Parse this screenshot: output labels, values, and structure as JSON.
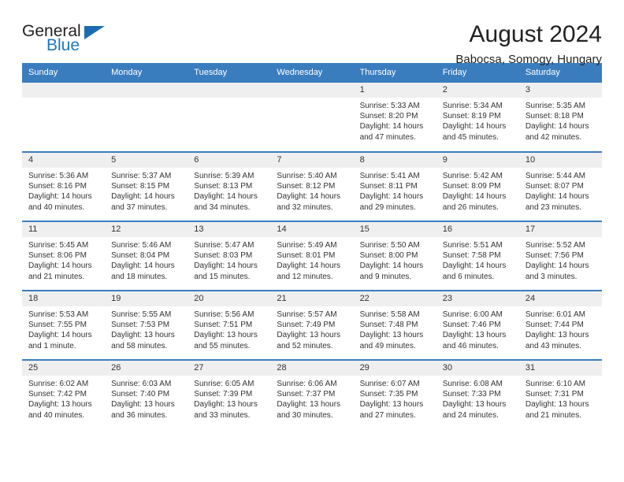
{
  "brand": {
    "line1": "General",
    "line2": "Blue",
    "triangle_color": "#1b6cb0"
  },
  "header": {
    "title": "August 2024",
    "subtitle": "Babocsa, Somogy, Hungary"
  },
  "colors": {
    "header_blue": "#3a7dbf",
    "daynum_band": "#efefef",
    "text": "#333333"
  },
  "weekday_headers": [
    "Sunday",
    "Monday",
    "Tuesday",
    "Wednesday",
    "Thursday",
    "Friday",
    "Saturday"
  ],
  "weeks": [
    [
      {
        "day": "",
        "sunrise": "",
        "sunset": "",
        "daylight": "",
        "empty": true
      },
      {
        "day": "",
        "sunrise": "",
        "sunset": "",
        "daylight": "",
        "empty": true
      },
      {
        "day": "",
        "sunrise": "",
        "sunset": "",
        "daylight": "",
        "empty": true
      },
      {
        "day": "",
        "sunrise": "",
        "sunset": "",
        "daylight": "",
        "empty": true
      },
      {
        "day": "1",
        "sunrise": "Sunrise: 5:33 AM",
        "sunset": "Sunset: 8:20 PM",
        "daylight": "Daylight: 14 hours and 47 minutes."
      },
      {
        "day": "2",
        "sunrise": "Sunrise: 5:34 AM",
        "sunset": "Sunset: 8:19 PM",
        "daylight": "Daylight: 14 hours and 45 minutes."
      },
      {
        "day": "3",
        "sunrise": "Sunrise: 5:35 AM",
        "sunset": "Sunset: 8:18 PM",
        "daylight": "Daylight: 14 hours and 42 minutes."
      }
    ],
    [
      {
        "day": "4",
        "sunrise": "Sunrise: 5:36 AM",
        "sunset": "Sunset: 8:16 PM",
        "daylight": "Daylight: 14 hours and 40 minutes."
      },
      {
        "day": "5",
        "sunrise": "Sunrise: 5:37 AM",
        "sunset": "Sunset: 8:15 PM",
        "daylight": "Daylight: 14 hours and 37 minutes."
      },
      {
        "day": "6",
        "sunrise": "Sunrise: 5:39 AM",
        "sunset": "Sunset: 8:13 PM",
        "daylight": "Daylight: 14 hours and 34 minutes."
      },
      {
        "day": "7",
        "sunrise": "Sunrise: 5:40 AM",
        "sunset": "Sunset: 8:12 PM",
        "daylight": "Daylight: 14 hours and 32 minutes."
      },
      {
        "day": "8",
        "sunrise": "Sunrise: 5:41 AM",
        "sunset": "Sunset: 8:11 PM",
        "daylight": "Daylight: 14 hours and 29 minutes."
      },
      {
        "day": "9",
        "sunrise": "Sunrise: 5:42 AM",
        "sunset": "Sunset: 8:09 PM",
        "daylight": "Daylight: 14 hours and 26 minutes."
      },
      {
        "day": "10",
        "sunrise": "Sunrise: 5:44 AM",
        "sunset": "Sunset: 8:07 PM",
        "daylight": "Daylight: 14 hours and 23 minutes."
      }
    ],
    [
      {
        "day": "11",
        "sunrise": "Sunrise: 5:45 AM",
        "sunset": "Sunset: 8:06 PM",
        "daylight": "Daylight: 14 hours and 21 minutes."
      },
      {
        "day": "12",
        "sunrise": "Sunrise: 5:46 AM",
        "sunset": "Sunset: 8:04 PM",
        "daylight": "Daylight: 14 hours and 18 minutes."
      },
      {
        "day": "13",
        "sunrise": "Sunrise: 5:47 AM",
        "sunset": "Sunset: 8:03 PM",
        "daylight": "Daylight: 14 hours and 15 minutes."
      },
      {
        "day": "14",
        "sunrise": "Sunrise: 5:49 AM",
        "sunset": "Sunset: 8:01 PM",
        "daylight": "Daylight: 14 hours and 12 minutes."
      },
      {
        "day": "15",
        "sunrise": "Sunrise: 5:50 AM",
        "sunset": "Sunset: 8:00 PM",
        "daylight": "Daylight: 14 hours and 9 minutes."
      },
      {
        "day": "16",
        "sunrise": "Sunrise: 5:51 AM",
        "sunset": "Sunset: 7:58 PM",
        "daylight": "Daylight: 14 hours and 6 minutes."
      },
      {
        "day": "17",
        "sunrise": "Sunrise: 5:52 AM",
        "sunset": "Sunset: 7:56 PM",
        "daylight": "Daylight: 14 hours and 3 minutes."
      }
    ],
    [
      {
        "day": "18",
        "sunrise": "Sunrise: 5:53 AM",
        "sunset": "Sunset: 7:55 PM",
        "daylight": "Daylight: 14 hours and 1 minute."
      },
      {
        "day": "19",
        "sunrise": "Sunrise: 5:55 AM",
        "sunset": "Sunset: 7:53 PM",
        "daylight": "Daylight: 13 hours and 58 minutes."
      },
      {
        "day": "20",
        "sunrise": "Sunrise: 5:56 AM",
        "sunset": "Sunset: 7:51 PM",
        "daylight": "Daylight: 13 hours and 55 minutes."
      },
      {
        "day": "21",
        "sunrise": "Sunrise: 5:57 AM",
        "sunset": "Sunset: 7:49 PM",
        "daylight": "Daylight: 13 hours and 52 minutes."
      },
      {
        "day": "22",
        "sunrise": "Sunrise: 5:58 AM",
        "sunset": "Sunset: 7:48 PM",
        "daylight": "Daylight: 13 hours and 49 minutes."
      },
      {
        "day": "23",
        "sunrise": "Sunrise: 6:00 AM",
        "sunset": "Sunset: 7:46 PM",
        "daylight": "Daylight: 13 hours and 46 minutes."
      },
      {
        "day": "24",
        "sunrise": "Sunrise: 6:01 AM",
        "sunset": "Sunset: 7:44 PM",
        "daylight": "Daylight: 13 hours and 43 minutes."
      }
    ],
    [
      {
        "day": "25",
        "sunrise": "Sunrise: 6:02 AM",
        "sunset": "Sunset: 7:42 PM",
        "daylight": "Daylight: 13 hours and 40 minutes."
      },
      {
        "day": "26",
        "sunrise": "Sunrise: 6:03 AM",
        "sunset": "Sunset: 7:40 PM",
        "daylight": "Daylight: 13 hours and 36 minutes."
      },
      {
        "day": "27",
        "sunrise": "Sunrise: 6:05 AM",
        "sunset": "Sunset: 7:39 PM",
        "daylight": "Daylight: 13 hours and 33 minutes."
      },
      {
        "day": "28",
        "sunrise": "Sunrise: 6:06 AM",
        "sunset": "Sunset: 7:37 PM",
        "daylight": "Daylight: 13 hours and 30 minutes."
      },
      {
        "day": "29",
        "sunrise": "Sunrise: 6:07 AM",
        "sunset": "Sunset: 7:35 PM",
        "daylight": "Daylight: 13 hours and 27 minutes."
      },
      {
        "day": "30",
        "sunrise": "Sunrise: 6:08 AM",
        "sunset": "Sunset: 7:33 PM",
        "daylight": "Daylight: 13 hours and 24 minutes."
      },
      {
        "day": "31",
        "sunrise": "Sunrise: 6:10 AM",
        "sunset": "Sunset: 7:31 PM",
        "daylight": "Daylight: 13 hours and 21 minutes."
      }
    ]
  ]
}
